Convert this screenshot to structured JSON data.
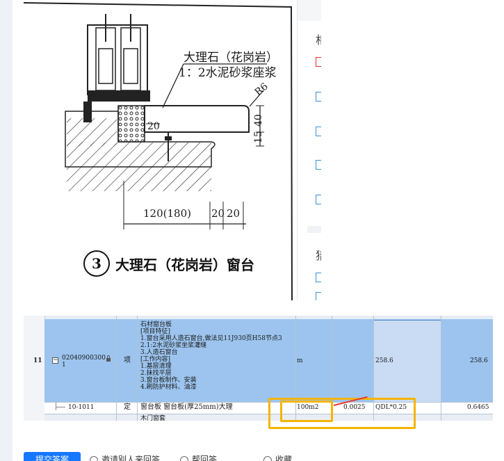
{
  "drawing": {
    "material_label_1": "大理石（花岗岩）",
    "material_label_2": "1：2水泥砂浆座浆",
    "radius_label": "R6",
    "dim_20_top": "20",
    "dim_40": "40",
    "dim_15": "15",
    "dim_120": "120(180)",
    "dim_20_a": "20",
    "dim_20_b": "20",
    "detail_number": "3",
    "caption": "大理石（花岗岩）窗台"
  },
  "side_panel": {
    "header_1": "相",
    "header_2": "猎",
    "colors": {
      "checkbox": "#3a8fd8",
      "checkbox_alert": "#d93025"
    }
  },
  "sheet": {
    "row_11": {
      "row_number": "11",
      "code_line1": "02040900300",
      "code_line2": "1",
      "type": "项",
      "description": [
        "石材窗台板",
        "[项目特征]",
        "1.窗台采用人造石窗台,做法见11J930页H58节点3",
        "2.1:2水泥砂浆坐浆灌缝",
        "3.人造石窗台",
        "[工作内容]",
        "1.基层清理",
        "2.抹找平层",
        "3.窗台板制作、安装",
        "4.刷防护材料、油漆"
      ],
      "unit": "m",
      "quantity_expr": "258.6",
      "quantity": "258.6"
    },
    "row_sub": {
      "code": "10-1011",
      "type": "定",
      "description": "窗台板 窗台板(厚25mm)大理",
      "unit": "100m2",
      "coefficient": "0.0025",
      "quantity_expr": "QDL*0.25",
      "quantity": "0.6465"
    },
    "next_row_text": "木门窗套",
    "colors": {
      "row_selected": "#9cc4ee",
      "highlight": "#f5b400"
    }
  },
  "toolbar": {
    "primary_button": "提交答案",
    "option_1": "邀请别人来回答",
    "option_2": "帮回答",
    "option_3": "收藏"
  }
}
